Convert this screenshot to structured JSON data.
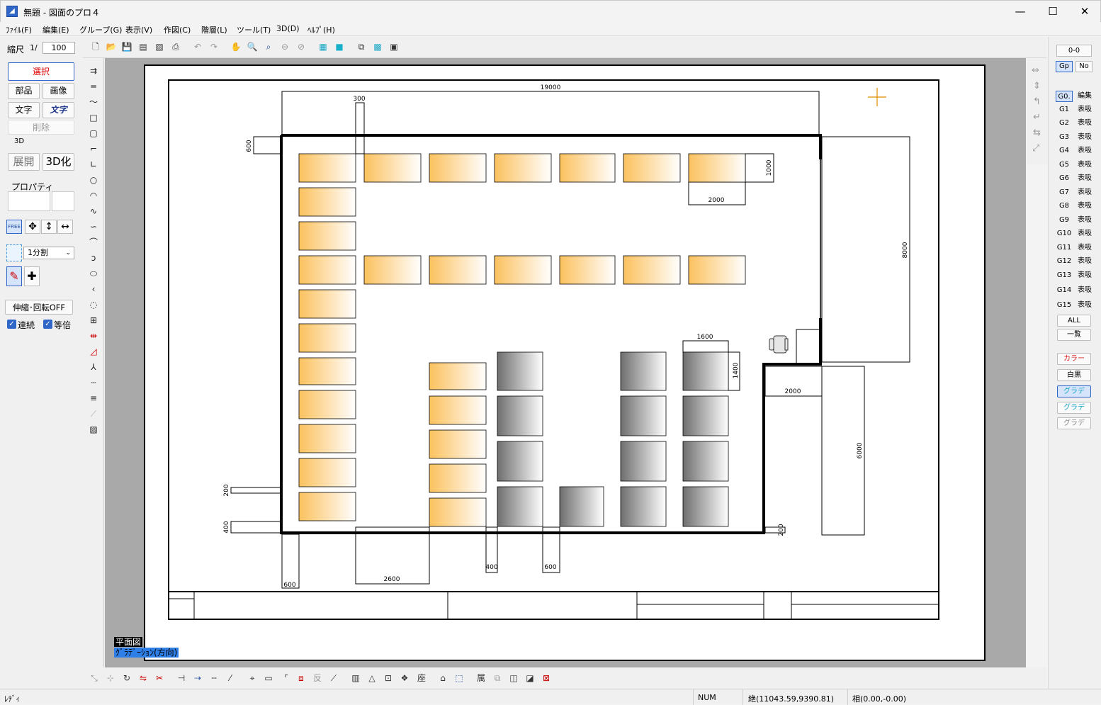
{
  "window": {
    "title": "無題 - 図面のプロ４",
    "app_icon": "app-icon",
    "minimize": "—",
    "maximize": "☐",
    "close": "✕"
  },
  "menu": [
    "ﾌｧｲﾙ(F)",
    "編集(E)",
    "グループ(G)",
    "表示(V)",
    "作図(C)",
    "階層(L)",
    "ツール(T)",
    "3D(D)",
    "ﾍﾙﾌﾟ(H)"
  ],
  "left": {
    "scale_label": "縮尺",
    "scale_prefix": "1/",
    "scale_value": "100",
    "select": "選択",
    "parts": "部品",
    "image": "画像",
    "text": "文字",
    "text2": "文字",
    "delete": "削除",
    "section_3d": "3D",
    "expand": "展開",
    "to3d": "3D化",
    "property": "プロパティ",
    "free": "FREE",
    "divide": "1分割",
    "stretch": "伸縮･回転OFF",
    "continuous": "連続",
    "same_scale": "等倍"
  },
  "right": {
    "layer": "0-0",
    "gp": "Gp",
    "no": "No",
    "groups": [
      {
        "id": "G0.",
        "state": "編集"
      },
      {
        "id": "G1",
        "state": "表吸"
      },
      {
        "id": "G2",
        "state": "表吸"
      },
      {
        "id": "G3",
        "state": "表吸"
      },
      {
        "id": "G4",
        "state": "表吸"
      },
      {
        "id": "G5",
        "state": "表吸"
      },
      {
        "id": "G6",
        "state": "表吸"
      },
      {
        "id": "G7",
        "state": "表吸"
      },
      {
        "id": "G8",
        "state": "表吸"
      },
      {
        "id": "G9",
        "state": "表吸"
      },
      {
        "id": "G10",
        "state": "表吸"
      },
      {
        "id": "G11",
        "state": "表吸"
      },
      {
        "id": "G12",
        "state": "表吸"
      },
      {
        "id": "G13",
        "state": "表吸"
      },
      {
        "id": "G14",
        "state": "表吸"
      },
      {
        "id": "G15",
        "state": "表吸"
      }
    ],
    "all": "ALL",
    "list": "一覧",
    "color": "カラー",
    "mono": "白黒",
    "grad1": "グラデ",
    "grad2": "グラデ",
    "grad3": "グラデ"
  },
  "drawing": {
    "dims": [
      "19000",
      "300",
      "600",
      "1000",
      "2000",
      "8000",
      "1600",
      "1400",
      "2000",
      "6000",
      "200",
      "400",
      "400",
      "600",
      "2600",
      "600",
      "200"
    ]
  },
  "labels": {
    "plan": "平面図",
    "mode": "ｸﾞﾗﾃﾞｰｼｮﾝ(方向)"
  },
  "status": {
    "ready": "ﾚﾃﾞｨ",
    "num": "NUM",
    "abs": "絶(11043.59,9390.81)",
    "rel": "相(0.00,-0.00)"
  },
  "colors": {
    "accent": "#2f66c8",
    "desk": "#fbc15e",
    "gray": "#6e6e6e",
    "wall": "#000000"
  }
}
